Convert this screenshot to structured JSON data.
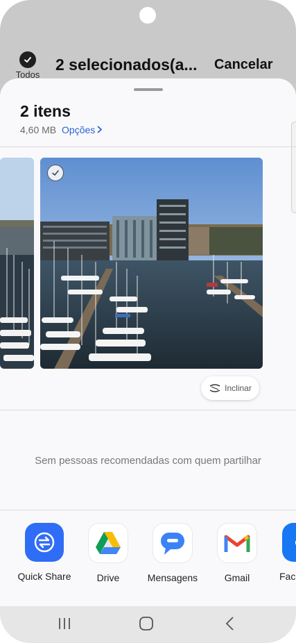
{
  "header": {
    "select_all_label": "Todos",
    "selection_title": "2 selecionados(a...",
    "cancel_label": "Cancelar"
  },
  "sheet": {
    "item_count": "2 itens",
    "size": "4,60 MB",
    "options_label": "Opções",
    "incline_label": "Inclinar",
    "no_people_text": "Sem pessoas recomendadas com quem partilhar"
  },
  "apps": [
    {
      "label": "Quick Share",
      "icon": "quick-share-icon"
    },
    {
      "label": "Drive",
      "icon": "google-drive-icon"
    },
    {
      "label": "Mensagens",
      "icon": "messages-icon"
    },
    {
      "label": "Gmail",
      "icon": "gmail-icon"
    },
    {
      "label": "Fac",
      "icon": "facebook-icon"
    }
  ],
  "colors": {
    "accent": "#2b63d0",
    "quick_share": "#2f6df6",
    "messages": "#3b82f6"
  }
}
